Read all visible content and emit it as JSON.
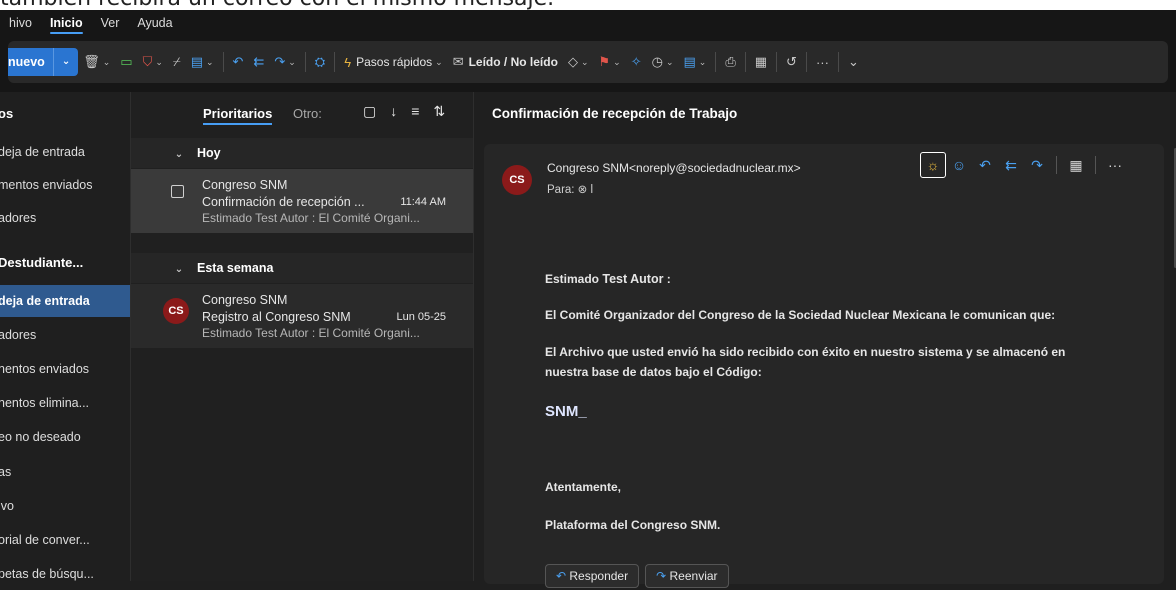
{
  "caption": "también recibirá un correo con el mismo mensaje.",
  "menu": [
    "hivo",
    "Inicio",
    "Ver",
    "Ayuda"
  ],
  "menu_active": "Inicio",
  "toolbar": {
    "new_label": "nuevo",
    "quick_steps": "Pasos rápidos",
    "read_unread": "Leído / No leído",
    "more": "···"
  },
  "folders": {
    "items": [
      {
        "label": "os",
        "style": "head"
      },
      {
        "label": "deja de entrada",
        "style": "normal"
      },
      {
        "label": "mentos enviados",
        "style": "normal"
      },
      {
        "label": "adores",
        "style": "normal"
      },
      {
        "label": "Destudiante...",
        "style": "head"
      },
      {
        "label": "deja de entrada",
        "style": "selected"
      },
      {
        "label": "adores",
        "style": "normal"
      },
      {
        "label": "nentos enviados",
        "style": "normal"
      },
      {
        "label": "nentos elimina...",
        "style": "normal"
      },
      {
        "label": "eo no deseado",
        "style": "normal"
      },
      {
        "label": "as",
        "style": "normal"
      },
      {
        "label": "ivo",
        "style": "normal"
      },
      {
        "label": "orial de conver...",
        "style": "normal"
      },
      {
        "label": "petas de búsqu...",
        "style": "normal"
      }
    ]
  },
  "list": {
    "tab_focused": "Prioritarios",
    "tab_other": "Otro:",
    "groups": [
      {
        "label": "Hoy",
        "messages": [
          {
            "from": "Congreso SNM",
            "subject": "Confirmación de recepción ...",
            "time": "11:44 AM",
            "preview": "Estimado Test Autor : El Comité Organi...",
            "selected": true
          }
        ]
      },
      {
        "label": "Esta semana",
        "messages": [
          {
            "from": "Congreso SNM",
            "subject": "Registro al Congreso SNM",
            "time": "Lun 05-25",
            "preview": "Estimado Test Autor : El Comité Organi...",
            "avatar": "CS",
            "selected": false
          }
        ]
      }
    ]
  },
  "reading": {
    "title": "Confirmación de recepción de Trabajo",
    "avatar": "CS",
    "sender": "Congreso SNM<noreply@sociedadnuclear.mx>",
    "to": "Para: ⊗ l",
    "greeting_prefix": "Estimado ",
    "greeting_name": "Test Autor",
    "greeting_suffix": " :",
    "para1": "El Comité Organizador del Congreso de la Sociedad Nuclear Mexicana le comunican que:",
    "para2a": "El Archivo que usted envió ha sido recibido con éxito en nuestro sistema y se almacenó en",
    "para2b": "nuestra base de datos bajo el Código:",
    "code": "SNM_",
    "closing": "Atentamente,",
    "signature": "Plataforma del Congreso SNM.",
    "reply_label": "Responder",
    "forward_label": "Reenviar"
  }
}
